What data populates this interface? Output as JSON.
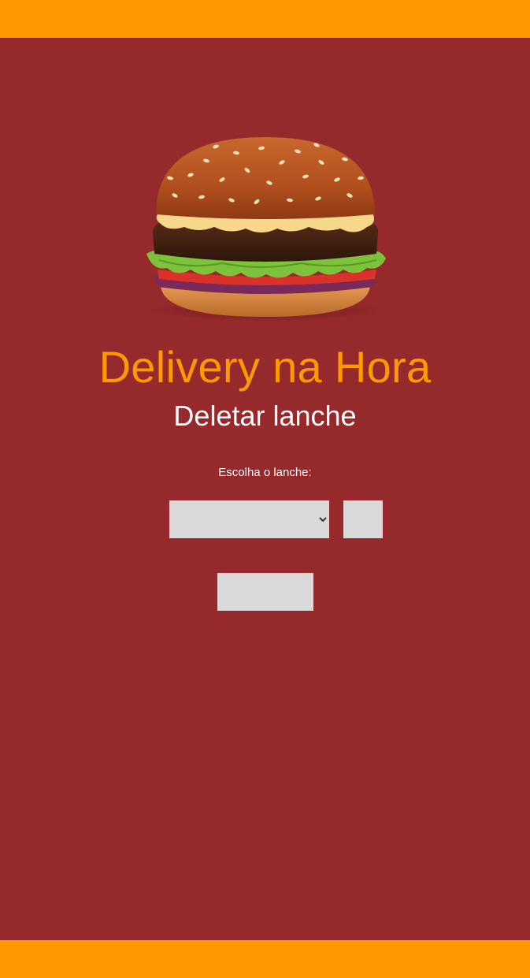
{
  "header": {
    "bar_color": "#ff9900"
  },
  "hero": {
    "image": "hamburger-image"
  },
  "page": {
    "title": "Delivery na Hora",
    "subtitle": "Deletar lanche",
    "background_color": "#96292b",
    "accent_color": "#ff9900"
  },
  "form": {
    "label": "Escolha o lanche:",
    "select_value": "",
    "small_button_label": "",
    "submit_label": ""
  },
  "footer": {
    "bar_color": "#ff9900"
  }
}
